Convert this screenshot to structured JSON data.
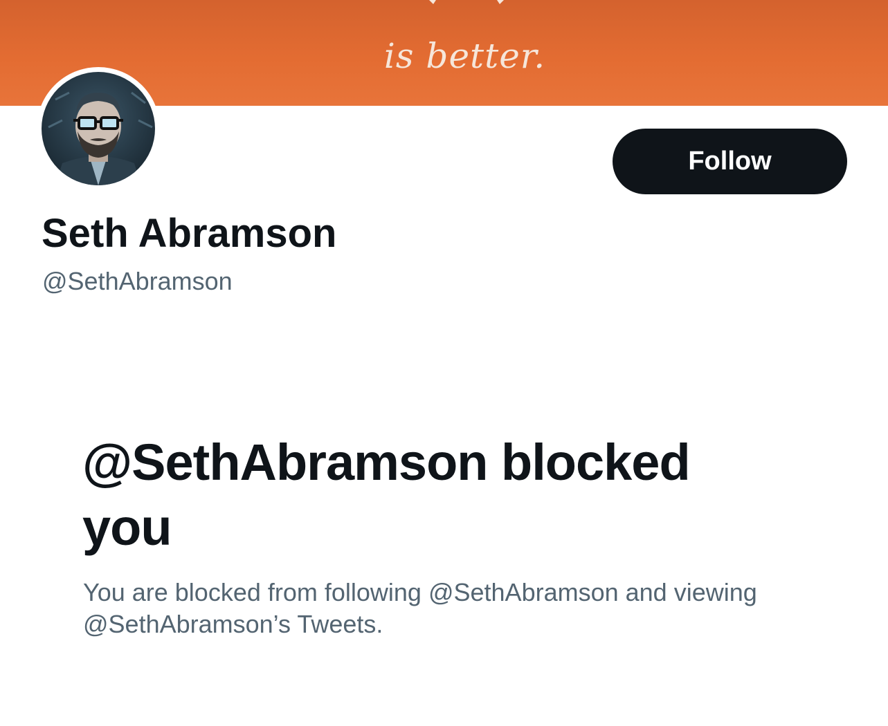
{
  "banner": {
    "text": "is better."
  },
  "profile": {
    "display_name": "Seth Abramson",
    "handle": "@SethAbramson",
    "follow_label": "Follow"
  },
  "block_notice": {
    "title": "@SethAbramson blocked you",
    "description": "You are blocked from following @SethAbramson and viewing @SethAbramson’s Tweets."
  },
  "colors": {
    "banner": "#e36c32",
    "button_bg": "#0f1419",
    "text_primary": "#0f1419",
    "text_secondary": "#536471"
  }
}
